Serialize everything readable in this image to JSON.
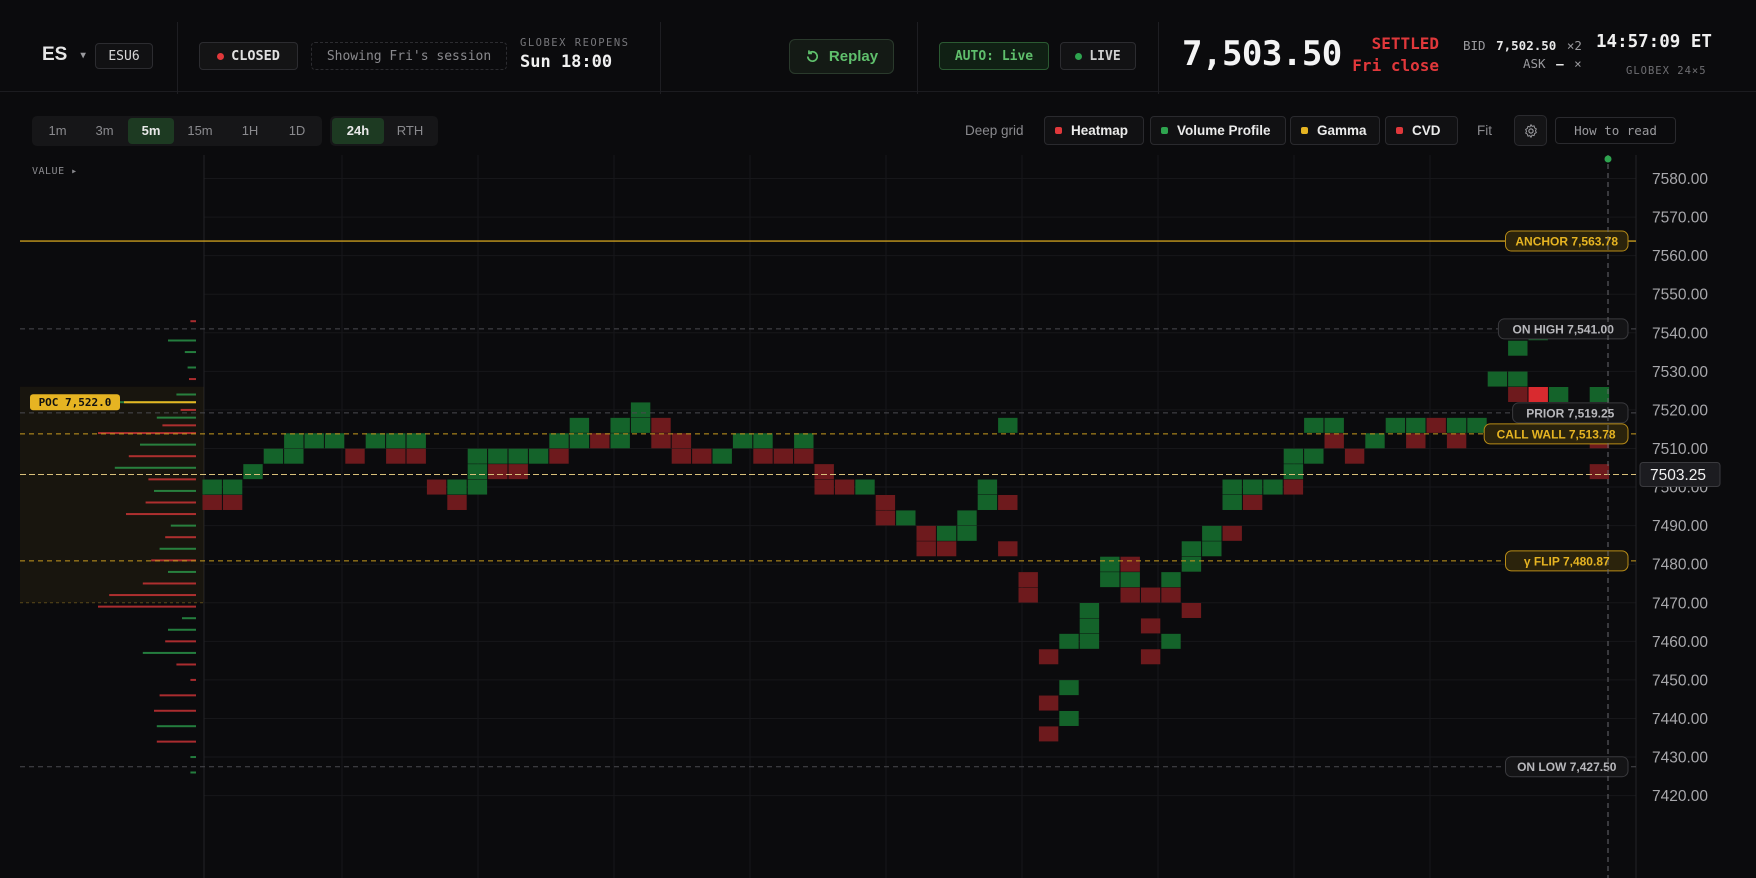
{
  "header": {
    "symbol": "ES",
    "symbol_caret": "▾",
    "contract": "ESU6",
    "status": "CLOSED",
    "session_note": "Showing Fri's session",
    "reopen_label": "GLOBEX REOPENS",
    "reopen_time": "Sun 18:00",
    "replay_label": "Replay",
    "auto_label": "AUTO: Live",
    "live_label": "LIVE",
    "price": "7,503.50",
    "settled_label": "SETTLED",
    "settled_sub": "Fri close",
    "bid_label": "BID",
    "bid_value": "7,502.50",
    "bid_size": "×2",
    "ask_label": "ASK",
    "ask_value": "–",
    "ask_size": "×",
    "clock": "14:57:09 ET",
    "session_type": "GLOBEX 24×5"
  },
  "toolbar": {
    "timeframes": [
      "1m",
      "3m",
      "5m",
      "15m",
      "1H",
      "1D"
    ],
    "active_timeframe": "5m",
    "sessions": [
      "24h",
      "RTH"
    ],
    "active_session": "24h",
    "deep_grid_label": "Deep grid",
    "layers": [
      {
        "label": "Heatmap",
        "color": "#e0383b"
      },
      {
        "label": "Volume Profile",
        "color": "#2ea44f"
      },
      {
        "label": "Gamma",
        "color": "#e6b422"
      },
      {
        "label": "CVD",
        "color": "#e0383b"
      }
    ],
    "fit_label": "Fit",
    "settings_icon": "gear-icon",
    "how_to_read_label": "How to read"
  },
  "chart_data": {
    "type": "heatmap",
    "profile_header": "VALUE ▸",
    "y_axis": {
      "min": 7420,
      "max": 7580,
      "ticks": [
        "7580.00",
        "7570.00",
        "7560.00",
        "7550.00",
        "7540.00",
        "7530.00",
        "7520.00",
        "7510.00",
        "7500.00",
        "7490.00",
        "7480.00",
        "7470.00",
        "7460.00",
        "7450.00",
        "7440.00",
        "7430.00",
        "7420.00"
      ]
    },
    "current_price": {
      "value": 7503.25,
      "label": "7503.25"
    },
    "poc": {
      "value": 7522.0,
      "label": "POC 7,522.0"
    },
    "value_area": [
      7470,
      7526
    ],
    "levels": [
      {
        "label": "ANCHOR 7,563.78",
        "value": 7563.78,
        "kind": "gold-solid"
      },
      {
        "label": "ON HIGH 7,541.00",
        "value": 7541.0,
        "kind": "gray-dashed"
      },
      {
        "label": "PRIOR 7,519.25",
        "value": 7519.25,
        "kind": "gray-dashed"
      },
      {
        "label": "CALL WALL 7,513.78",
        "value": 7513.78,
        "kind": "gold-dashed"
      },
      {
        "label": "γ FLIP 7,480.87",
        "value": 7480.87,
        "kind": "gold-dashed"
      },
      {
        "label": "ON LOW 7,427.50",
        "value": 7427.5,
        "kind": "gray-dashed"
      }
    ],
    "colors": {
      "green": "#14632a",
      "red": "#6e1a1d",
      "gold": "#e6b422",
      "background": "#0b0b0d"
    },
    "cells": [
      [
        0,
        7500,
        "g"
      ],
      [
        0,
        7496,
        "r"
      ],
      [
        1,
        7500,
        "g"
      ],
      [
        1,
        7496,
        "r"
      ],
      [
        2,
        7504,
        "g"
      ],
      [
        3,
        7508,
        "g"
      ],
      [
        4,
        7508,
        "g"
      ],
      [
        4,
        7512,
        "g"
      ],
      [
        5,
        7512,
        "g"
      ],
      [
        6,
        7512,
        "g"
      ],
      [
        7,
        7508,
        "r"
      ],
      [
        8,
        7512,
        "g"
      ],
      [
        9,
        7512,
        "g"
      ],
      [
        9,
        7508,
        "r"
      ],
      [
        10,
        7512,
        "g"
      ],
      [
        10,
        7508,
        "r"
      ],
      [
        11,
        7500,
        "r"
      ],
      [
        12,
        7500,
        "g"
      ],
      [
        12,
        7496,
        "r"
      ],
      [
        13,
        7508,
        "g"
      ],
      [
        13,
        7504,
        "g"
      ],
      [
        13,
        7500,
        "g"
      ],
      [
        14,
        7508,
        "g"
      ],
      [
        14,
        7504,
        "r"
      ],
      [
        15,
        7508,
        "g"
      ],
      [
        15,
        7504,
        "r"
      ],
      [
        16,
        7508,
        "g"
      ],
      [
        17,
        7512,
        "g"
      ],
      [
        17,
        7508,
        "r"
      ],
      [
        18,
        7516,
        "g"
      ],
      [
        18,
        7512,
        "g"
      ],
      [
        19,
        7512,
        "r"
      ],
      [
        20,
        7516,
        "g"
      ],
      [
        20,
        7512,
        "g"
      ],
      [
        21,
        7520,
        "g"
      ],
      [
        21,
        7516,
        "g"
      ],
      [
        22,
        7516,
        "r"
      ],
      [
        22,
        7512,
        "r"
      ],
      [
        23,
        7512,
        "r"
      ],
      [
        23,
        7508,
        "r"
      ],
      [
        24,
        7508,
        "r"
      ],
      [
        25,
        7508,
        "g"
      ],
      [
        26,
        7512,
        "g"
      ],
      [
        27,
        7512,
        "g"
      ],
      [
        27,
        7508,
        "r"
      ],
      [
        28,
        7508,
        "r"
      ],
      [
        29,
        7512,
        "g"
      ],
      [
        29,
        7508,
        "r"
      ],
      [
        30,
        7504,
        "r"
      ],
      [
        30,
        7500,
        "r"
      ],
      [
        31,
        7500,
        "r"
      ],
      [
        32,
        7500,
        "g"
      ],
      [
        33,
        7496,
        "r"
      ],
      [
        33,
        7492,
        "r"
      ],
      [
        34,
        7492,
        "g"
      ],
      [
        35,
        7488,
        "r"
      ],
      [
        35,
        7484,
        "r"
      ],
      [
        36,
        7488,
        "g"
      ],
      [
        36,
        7484,
        "r"
      ],
      [
        37,
        7492,
        "g"
      ],
      [
        37,
        7488,
        "g"
      ],
      [
        38,
        7500,
        "g"
      ],
      [
        38,
        7496,
        "g"
      ],
      [
        39,
        7496,
        "r"
      ],
      [
        39,
        7484,
        "r"
      ],
      [
        39,
        7516,
        "g"
      ],
      [
        40,
        7476,
        "r"
      ],
      [
        40,
        7472,
        "r"
      ],
      [
        41,
        7456,
        "r"
      ],
      [
        41,
        7444,
        "r"
      ],
      [
        41,
        7436,
        "r"
      ],
      [
        42,
        7460,
        "g"
      ],
      [
        42,
        7448,
        "g"
      ],
      [
        42,
        7440,
        "g"
      ],
      [
        43,
        7468,
        "g"
      ],
      [
        43,
        7464,
        "g"
      ],
      [
        43,
        7460,
        "g"
      ],
      [
        44,
        7480,
        "g"
      ],
      [
        44,
        7476,
        "g"
      ],
      [
        45,
        7480,
        "r"
      ],
      [
        45,
        7476,
        "g"
      ],
      [
        45,
        7472,
        "r"
      ],
      [
        46,
        7472,
        "r"
      ],
      [
        46,
        7464,
        "r"
      ],
      [
        46,
        7456,
        "r"
      ],
      [
        47,
        7476,
        "g"
      ],
      [
        47,
        7472,
        "r"
      ],
      [
        47,
        7460,
        "g"
      ],
      [
        48,
        7468,
        "r"
      ],
      [
        48,
        7484,
        "g"
      ],
      [
        48,
        7480,
        "g"
      ],
      [
        49,
        7488,
        "g"
      ],
      [
        49,
        7484,
        "g"
      ],
      [
        50,
        7488,
        "r"
      ],
      [
        50,
        7500,
        "g"
      ],
      [
        50,
        7496,
        "g"
      ],
      [
        51,
        7500,
        "g"
      ],
      [
        51,
        7496,
        "r"
      ],
      [
        52,
        7500,
        "g"
      ],
      [
        53,
        7508,
        "g"
      ],
      [
        53,
        7504,
        "g"
      ],
      [
        53,
        7500,
        "r"
      ],
      [
        54,
        7516,
        "g"
      ],
      [
        54,
        7508,
        "g"
      ],
      [
        55,
        7516,
        "g"
      ],
      [
        55,
        7512,
        "r"
      ],
      [
        56,
        7508,
        "r"
      ],
      [
        57,
        7512,
        "g"
      ],
      [
        58,
        7516,
        "g"
      ],
      [
        59,
        7516,
        "g"
      ],
      [
        59,
        7512,
        "r"
      ],
      [
        60,
        7516,
        "r"
      ],
      [
        61,
        7516,
        "g"
      ],
      [
        61,
        7512,
        "r"
      ],
      [
        62,
        7516,
        "g"
      ],
      [
        63,
        7528,
        "g"
      ],
      [
        64,
        7536,
        "g"
      ],
      [
        64,
        7528,
        "g"
      ],
      [
        64,
        7524,
        "r"
      ],
      [
        65,
        7540,
        "g"
      ],
      [
        65,
        7524,
        "r"
      ],
      [
        66,
        7524,
        "g"
      ],
      [
        66,
        7520,
        "r"
      ],
      [
        68,
        7524,
        "g"
      ],
      [
        68,
        7512,
        "r"
      ],
      [
        68,
        7504,
        "r"
      ]
    ],
    "profile_bars": [
      [
        7543,
        0.04,
        "r"
      ],
      [
        7538,
        0.2,
        "g"
      ],
      [
        7535,
        0.08,
        "g"
      ],
      [
        7531,
        0.06,
        "g"
      ],
      [
        7528,
        0.05,
        "r"
      ],
      [
        7524,
        0.14,
        "g"
      ],
      [
        7522,
        0.55,
        "g"
      ],
      [
        7520,
        0.11,
        "r"
      ],
      [
        7518,
        0.28,
        "g"
      ],
      [
        7516,
        0.24,
        "r"
      ],
      [
        7514,
        0.7,
        "r"
      ],
      [
        7511,
        0.4,
        "g"
      ],
      [
        7508,
        0.48,
        "r"
      ],
      [
        7505,
        0.58,
        "g"
      ],
      [
        7502,
        0.34,
        "r"
      ],
      [
        7499,
        0.3,
        "g"
      ],
      [
        7496,
        0.36,
        "r"
      ],
      [
        7493,
        0.5,
        "r"
      ],
      [
        7490,
        0.18,
        "g"
      ],
      [
        7487,
        0.22,
        "r"
      ],
      [
        7484,
        0.26,
        "g"
      ],
      [
        7481,
        0.32,
        "r"
      ],
      [
        7478,
        0.2,
        "g"
      ],
      [
        7475,
        0.38,
        "r"
      ],
      [
        7472,
        0.62,
        "r"
      ],
      [
        7469,
        0.7,
        "r"
      ],
      [
        7466,
        0.1,
        "g"
      ],
      [
        7463,
        0.2,
        "g"
      ],
      [
        7460,
        0.22,
        "r"
      ],
      [
        7457,
        0.38,
        "g"
      ],
      [
        7454,
        0.14,
        "r"
      ],
      [
        7450,
        0.04,
        "r"
      ],
      [
        7446,
        0.26,
        "r"
      ],
      [
        7442,
        0.3,
        "r"
      ],
      [
        7438,
        0.28,
        "g"
      ],
      [
        7434,
        0.28,
        "r"
      ],
      [
        7430,
        0.04,
        "g"
      ],
      [
        7426,
        0.04,
        "g"
      ]
    ]
  }
}
